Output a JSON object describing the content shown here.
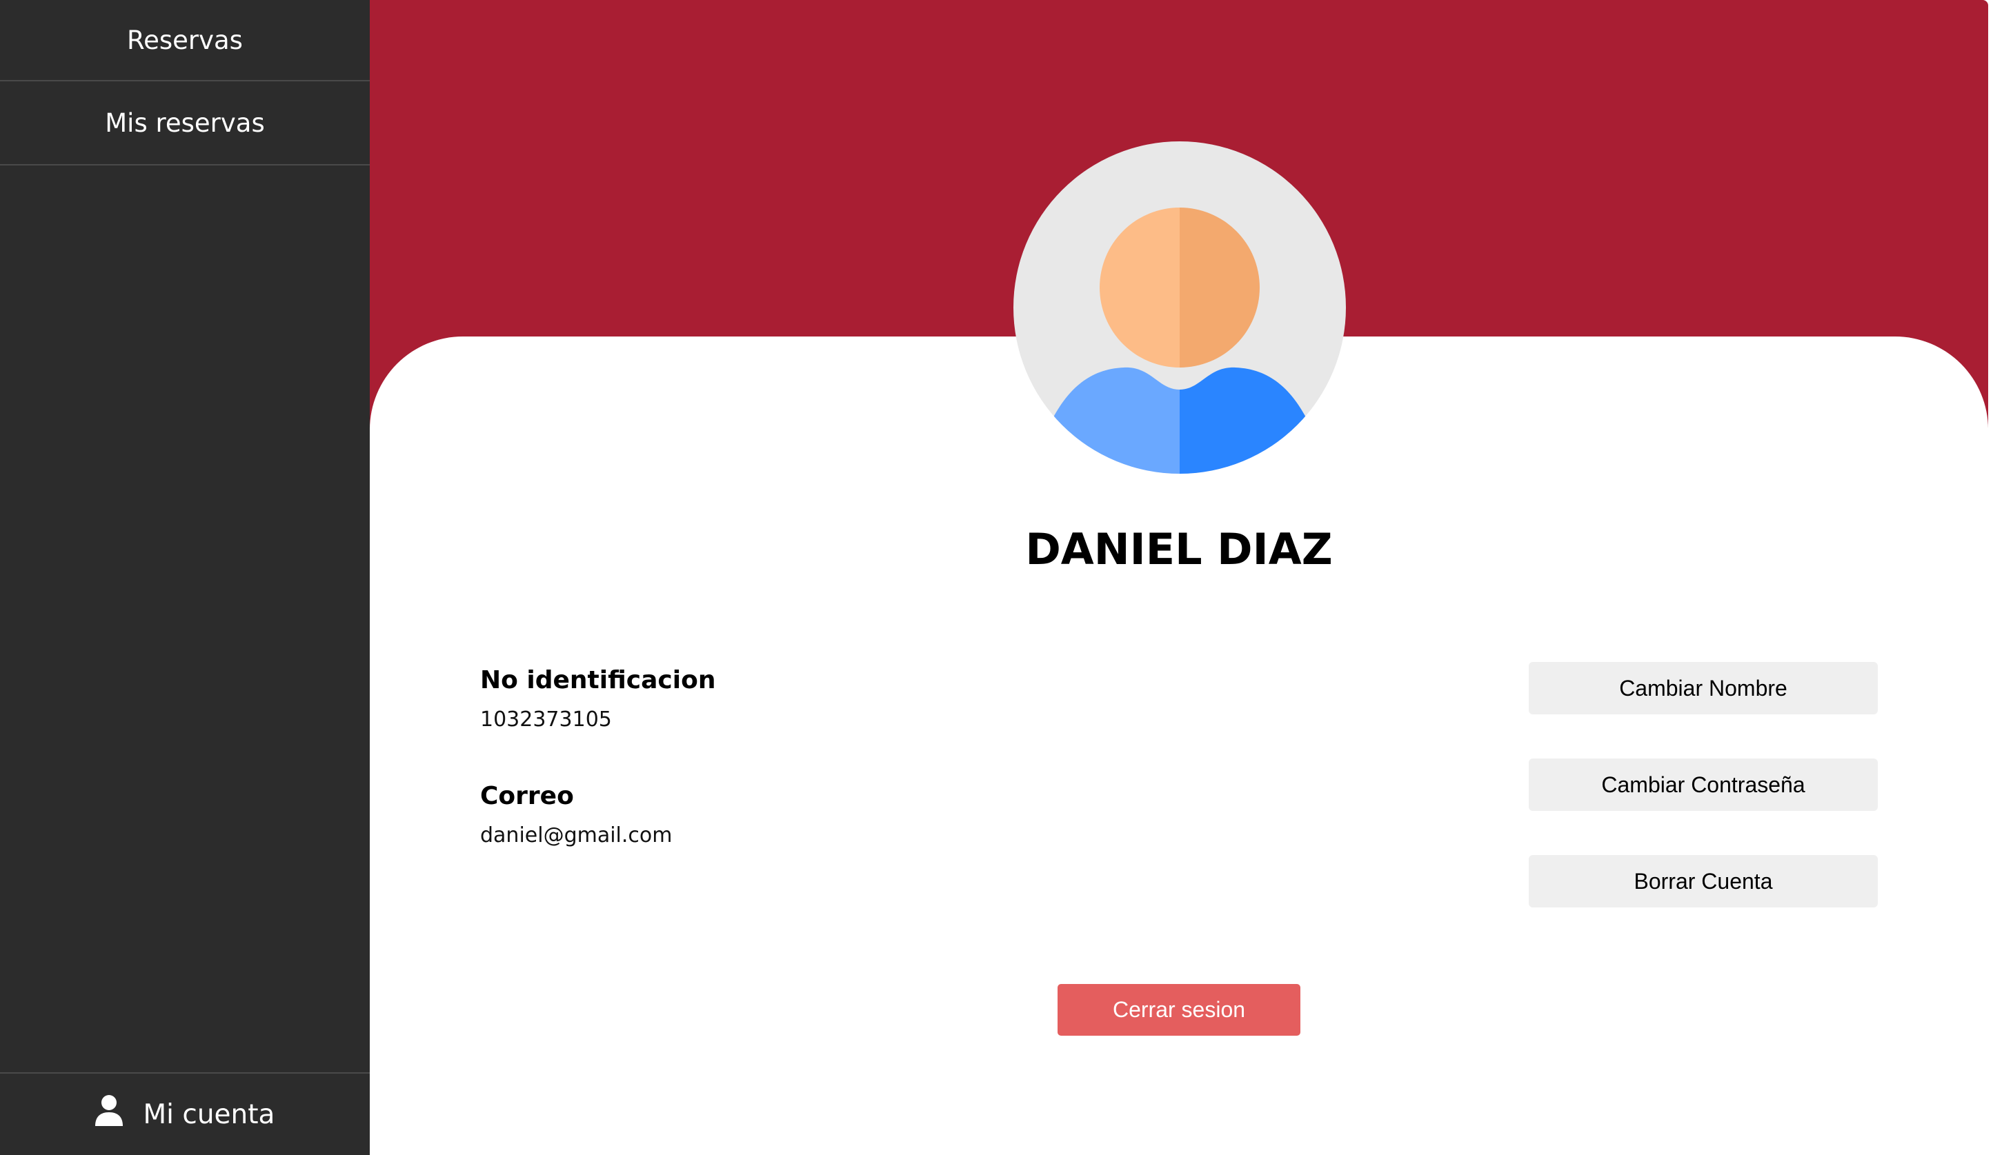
{
  "sidebar": {
    "items": [
      {
        "label": "Reservas"
      },
      {
        "label": "Mis reservas"
      }
    ],
    "account": {
      "label": "Mi cuenta",
      "icon": "user-icon"
    }
  },
  "colors": {
    "sidebar_bg": "#2c2c2c",
    "banner": "#a91e33",
    "logout": "#e45e5e",
    "button_bg": "#efefef"
  },
  "profile": {
    "avatar_icon": "user-avatar-icon",
    "name": "DANIEL DIAZ",
    "fields": [
      {
        "label": "No identificacion",
        "value": "1032373105"
      },
      {
        "label": "Correo",
        "value": "daniel@gmail.com"
      }
    ]
  },
  "actions": {
    "change_name": "Cambiar Nombre",
    "change_password": "Cambiar Contraseña",
    "delete_account": "Borrar Cuenta",
    "logout": "Cerrar sesion"
  }
}
